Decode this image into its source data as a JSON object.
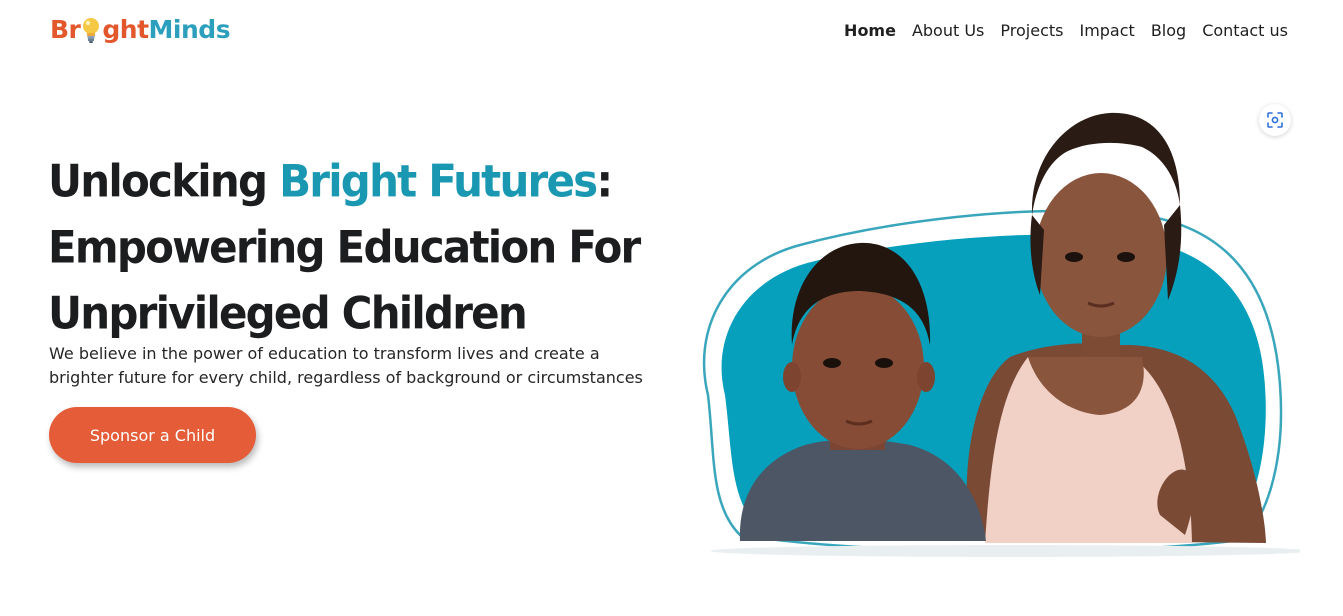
{
  "brand": {
    "part1_a": "Br",
    "part1_b": "ght",
    "part2": "Minds",
    "color_primary": "#e2572b",
    "color_secondary": "#2c9fbd",
    "icon": "lightbulb-icon"
  },
  "nav": {
    "items": [
      {
        "label": "Home",
        "active": true
      },
      {
        "label": "About Us",
        "active": false
      },
      {
        "label": "Projects",
        "active": false
      },
      {
        "label": "Impact",
        "active": false
      },
      {
        "label": "Blog",
        "active": false
      },
      {
        "label": "Contact us",
        "active": false
      }
    ]
  },
  "hero": {
    "title_lead": "Unlocking ",
    "title_accent": "Bright Futures",
    "title_colon": ":",
    "title_line2": "Empowering Education For",
    "title_line3": "Unprivileged Children",
    "description": "We believe in the power of education to transform lives and create a brighter future for every child, regardless of background or circumstances",
    "cta_label": "Sponsor a Child",
    "accent_color": "#1a98b1",
    "cta_color": "#e55c38"
  },
  "image_tools": {
    "scan_icon": "visual-search-icon"
  }
}
